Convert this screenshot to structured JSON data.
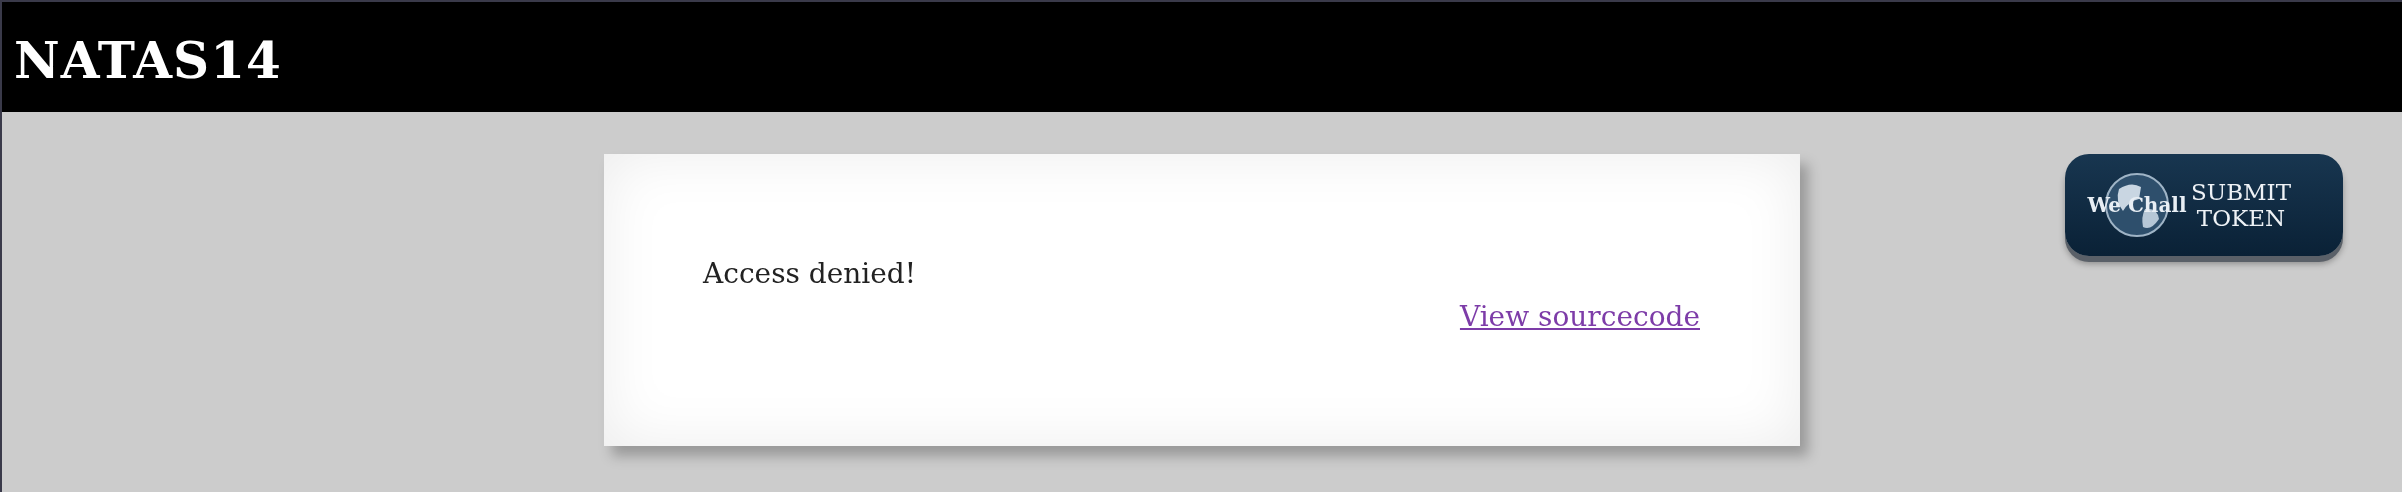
{
  "header": {
    "title": "NATAS14"
  },
  "content": {
    "message": "Access denied!",
    "link": "View sourcecode"
  },
  "submit_token": {
    "logo_text": "We Chall",
    "line_1": "SUBMIT",
    "line_2": "TOKEN"
  }
}
